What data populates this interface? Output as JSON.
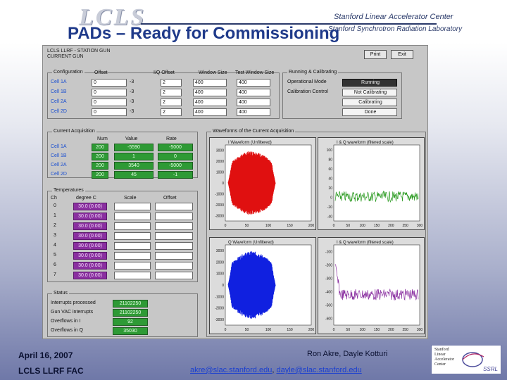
{
  "logo": {
    "lcls": "LCLS",
    "slac": "Stanford Linear Accelerator Center",
    "ssrl": "Stanford Synchrotron Radiation Laboratory"
  },
  "slide": {
    "title": "PADs – Ready for Commissioning"
  },
  "app": {
    "header": [
      "LCLS LLRF - STATION GUN",
      "CURRENT GUN"
    ],
    "buttons": {
      "print": "Print",
      "exit": "Exit"
    },
    "configuration": {
      "title": "Configuration",
      "headers": [
        "Offset",
        "I/Q Offset",
        "Window Size",
        "Test Window Size"
      ],
      "rows": [
        {
          "label": "Cell 1A",
          "offset": "0",
          "iq": "-3",
          "iq2": "2",
          "window": "400",
          "test": "400"
        },
        {
          "label": "Cell 1B",
          "offset": "0",
          "iq": "-3",
          "iq2": "2",
          "window": "400",
          "test": "400"
        },
        {
          "label": "Cell 2A",
          "offset": "0",
          "iq": "-3",
          "iq2": "2",
          "window": "400",
          "test": "400"
        },
        {
          "label": "Cell 2D",
          "offset": "0",
          "iq": "-3",
          "iq2": "2",
          "window": "400",
          "test": "400"
        }
      ]
    },
    "running": {
      "title": "Running & Calibrating",
      "items": [
        {
          "label": "Operational Mode",
          "value": "Running"
        },
        {
          "label": "Calibration Control",
          "value": "Not Calibrating"
        },
        {
          "label": "",
          "value": "Calibrating"
        },
        {
          "label": "",
          "value": "Done"
        }
      ]
    },
    "acquisition": {
      "title": "Current Acquisition",
      "headers": [
        "Num",
        "Value",
        "Rate"
      ],
      "rows": [
        {
          "label": "Cell 1A",
          "num": "200",
          "value": "-5590",
          "rate": "-5000"
        },
        {
          "label": "Cell 1B",
          "num": "200",
          "value": "1",
          "rate": "0"
        },
        {
          "label": "Cell 2A",
          "num": "200",
          "value": "3540",
          "rate": "-5000"
        },
        {
          "label": "Cell 2D",
          "num": "200",
          "value": "45",
          "rate": "-1"
        }
      ]
    },
    "temperatures": {
      "title": "Temperatures",
      "headers": [
        "Ch",
        "degree C",
        "Scale",
        "Offset"
      ],
      "rows": [
        "0",
        "1",
        "2",
        "3",
        "4",
        "5",
        "6",
        "7"
      ],
      "value_text": "30.0 (0.00)"
    },
    "status": {
      "title": "Status",
      "rows": [
        {
          "label": "Interrupts processed",
          "value": "21102250"
        },
        {
          "label": "Gun VAC interrupts",
          "value": "21102250"
        },
        {
          "label": "Overflows in I",
          "value": "92"
        },
        {
          "label": "Overflows in Q",
          "value": "35030"
        }
      ]
    },
    "waveforms_group": {
      "title": "Waveforms of the Current Acquisition"
    },
    "plots": [
      {
        "title": "I Waveform (Unfiltered)",
        "color": "#e01010",
        "y_ticks": [
          "3000",
          "2000",
          "1000",
          "0",
          "-1000",
          "-2000",
          "-3000"
        ],
        "x_ticks": [
          "0",
          "50",
          "100",
          "150",
          "200"
        ]
      },
      {
        "title": "I & Q waveform (filtered scale)",
        "color": "#2a9a20",
        "y_ticks": [
          "100",
          "80",
          "60",
          "40",
          "20",
          "0",
          "-20",
          "-40"
        ],
        "x_ticks": [
          "0",
          "50",
          "100",
          "150",
          "200",
          "250",
          "300"
        ]
      },
      {
        "title": "Q Waveform (Unfiltered)",
        "color": "#1020e0",
        "y_ticks": [
          "3000",
          "2000",
          "1000",
          "0",
          "-1000",
          "-2000",
          "-3000"
        ],
        "x_ticks": [
          "0",
          "50",
          "100",
          "150",
          "200"
        ]
      },
      {
        "title": "I & Q waveform (filtered scale)",
        "color": "#8a2fa0",
        "y_ticks": [
          "-100",
          "-200",
          "-300",
          "-400",
          "-500",
          "-600"
        ],
        "x_ticks": [
          "0",
          "50",
          "100",
          "150",
          "200",
          "250",
          "300"
        ]
      }
    ]
  },
  "footer": {
    "date": "April 16, 2007",
    "org": "LCLS LLRF FAC",
    "authors": "Ron Akre, Dayle Kotturi",
    "email1": "akre@slac.stanford.edu",
    "separator": ",",
    "email2": "dayle@slac.stanford.edu",
    "logo_lines": [
      "Stanford",
      "Linear",
      "Accelerator",
      "Center"
    ],
    "logo_ssrl": "SSRL"
  },
  "colors": {
    "title": "#1f3a8a",
    "cell_label": "#1a4fd0",
    "field_green": "#2e9a35",
    "field_purple": "#8a2fa0"
  }
}
